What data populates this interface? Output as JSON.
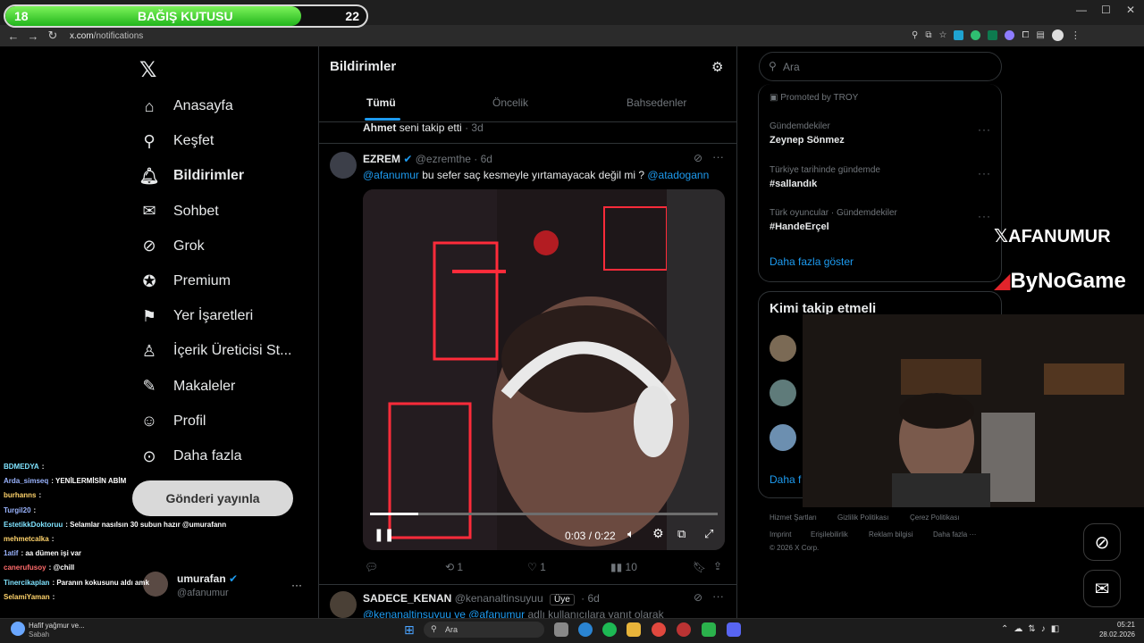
{
  "donation": {
    "left": "18",
    "title": "BAĞIŞ KUTUSU",
    "right": "22",
    "progress": 0.82
  },
  "browser": {
    "url_domain": "x.com",
    "url_path": "/notifications"
  },
  "sidebar": {
    "items": [
      {
        "label": "Anasayfa",
        "icon": "home-icon"
      },
      {
        "label": "Keşfet",
        "icon": "search-icon"
      },
      {
        "label": "Bildirimler",
        "icon": "bell-icon"
      },
      {
        "label": "Sohbet",
        "icon": "mail-icon"
      },
      {
        "label": "Grok",
        "icon": "grok-icon"
      },
      {
        "label": "Premium",
        "icon": "verified-icon"
      },
      {
        "label": "Yer İşaretleri",
        "icon": "bookmark-icon"
      },
      {
        "label": "İçerik Üreticisi St...",
        "icon": "creator-icon"
      },
      {
        "label": "Makaleler",
        "icon": "articles-icon"
      },
      {
        "label": "Profil",
        "icon": "person-icon"
      },
      {
        "label": "Daha fazla",
        "icon": "more-icon"
      }
    ],
    "post_button": "Gönderi yayınla",
    "account": {
      "name": "umurafan",
      "handle": "@afanumur"
    }
  },
  "main": {
    "title": "Bildirimler",
    "tabs": [
      "Tümü",
      "Öncelik",
      "Bahsedenler"
    ],
    "follow_notice": {
      "name": "Ahmet",
      "text": "seni takip etti",
      "time": "· 3d"
    },
    "tweet": {
      "name": "EZREM",
      "handle": "@ezremthe",
      "time": "· 6d",
      "mention1": "@afanumur",
      "text": "bu sefer saç kesmeyle yırtamayacak değil mi ?",
      "mention2": "@atadogann",
      "video_time": "0:03 / 0:22",
      "video_progress": 0.14,
      "replies": "",
      "retweets": "1",
      "likes": "1",
      "views": "10"
    },
    "tweet2": {
      "name": "SADECE_KENAN",
      "handle": "@kenanaltinsuyuu",
      "badge": "Üye",
      "time": "· 6d",
      "text_prefix": "@kenanaltinsuyuu ve @afanumur",
      "text": "adlı kullanıcılara yanıt olarak"
    }
  },
  "right": {
    "search_placeholder": "Ara",
    "promoted": "Promoted by TROY",
    "trends": [
      {
        "category": "Gündemdekiler",
        "name": "Zeynep Sönmez"
      },
      {
        "category": "Türkiye tarihinde gündemde",
        "name": "#sallandık"
      },
      {
        "category": "Türk oyuncular · Gündemdekiler",
        "name": "#HandeErçel"
      }
    ],
    "show_more": "Daha fazla göster",
    "who_to_follow": "Kimi takip etmeli",
    "wtf_more": "Daha f",
    "footer": [
      "Hizmet Şartları",
      "Gizlilik Politikası",
      "Çerez Politikası",
      "Imprint",
      "Erişilebilirlik",
      "Reklam bilgisi",
      "Daha fazla ···",
      "© 2026 X Corp."
    ]
  },
  "overlay": {
    "brand1": "AFANUMUR",
    "brand2": "ByNoGame"
  },
  "chat": [
    {
      "user": "BDMEDYA",
      "msg": ":",
      "color": "#7fe3ff"
    },
    {
      "user": "Arda_simseq",
      "msg": ": YENİLERMİSİN ABİM",
      "color": "#9ab4ff"
    },
    {
      "user": "burhanns",
      "msg": ":",
      "color": "#ffd36b"
    },
    {
      "user": "Turgil20",
      "msg": ":",
      "color": "#9ab4ff"
    },
    {
      "user": "EstetikkDoktoruu",
      "msg": ": Selamlar nasılsın 30 subun hazır @umurafann",
      "color": "#7fe3ff"
    },
    {
      "user": "mehmetcalka",
      "msg": ":",
      "color": "#ffd36b"
    },
    {
      "user": "1atif",
      "msg": ": aa dümen işi var",
      "color": "#9ab4ff"
    },
    {
      "user": "canerufusoy",
      "msg": ": @chill",
      "color": "#ff6b6b"
    },
    {
      "user": "Tinercikaplan",
      "msg": ": Paranın kokusunu aldı amk",
      "color": "#7fe3ff"
    },
    {
      "user": "SelamiYaman",
      "msg": ":",
      "color": "#ffd36b"
    }
  ],
  "taskbar": {
    "weather_title": "Hafif yağmur ve...",
    "weather_sub": "Sabah",
    "search": "Ara",
    "time": "05:21",
    "date": "28.02.2026"
  }
}
